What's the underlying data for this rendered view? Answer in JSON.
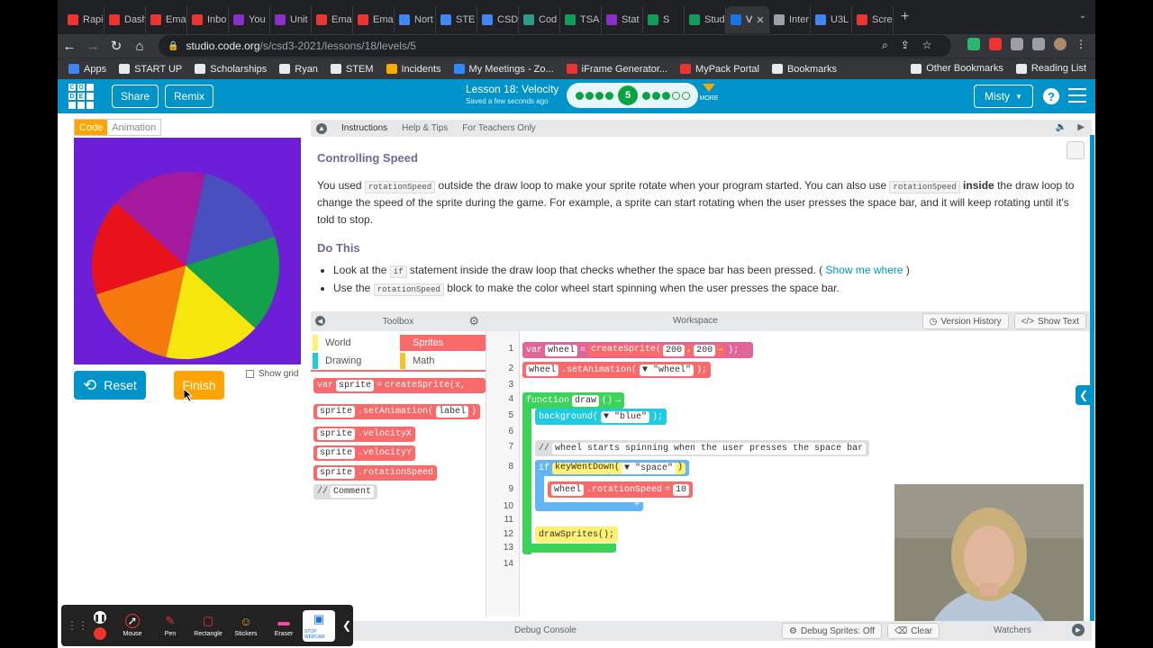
{
  "browser": {
    "tabs": [
      {
        "label": "Rapi",
        "color": "#e33"
      },
      {
        "label": "Dash",
        "color": "#e33"
      },
      {
        "label": "Ema",
        "color": "#e33"
      },
      {
        "label": "Inbo",
        "color": "#e33"
      },
      {
        "label": "You",
        "color": "#8b2fc9"
      },
      {
        "label": "Unit",
        "color": "#8b2fc9"
      },
      {
        "label": "Ema",
        "color": "#e33"
      },
      {
        "label": "Ema",
        "color": "#e33"
      },
      {
        "label": "Nort",
        "color": "#4285f4"
      },
      {
        "label": "STE",
        "color": "#4285f4"
      },
      {
        "label": "CSD",
        "color": "#4285f4"
      },
      {
        "label": "Cod",
        "color": "#2e9a8a"
      },
      {
        "label": "TSA",
        "color": "#0f9d58"
      },
      {
        "label": "Stat",
        "color": "#8b2fc9"
      },
      {
        "label": "S",
        "color": "#0f9d58"
      },
      {
        "label": "Stud",
        "color": "#0f9d58"
      },
      {
        "label": "V",
        "color": "#1a73e8",
        "active": true
      },
      {
        "label": "Inter",
        "color": "#9aa0a6"
      },
      {
        "label": "U3L",
        "color": "#4285f4"
      },
      {
        "label": "Scre",
        "color": "#e33"
      }
    ],
    "url_host": "studio.code.org",
    "url_path": "/s/csd3-2021/lessons/18/levels/5",
    "bookmarks": [
      "Apps",
      "START UP",
      "Scholarships",
      "Ryan",
      "STEM",
      "Incidents",
      "My Meetings - Zo...",
      "iFrame Generator...",
      "MyPack Portal",
      "Bookmarks"
    ],
    "bookmarks_right": [
      "Other Bookmarks",
      "Reading List"
    ]
  },
  "header": {
    "share": "Share",
    "remix": "Remix",
    "lesson_title": "Lesson 18: Velocity",
    "saved": "Saved a few seconds ago",
    "current_level": "5",
    "more": "MORE",
    "user": "Misty"
  },
  "visualization": {
    "tab_code": "Code",
    "tab_animation": "Animation",
    "reset": "Reset",
    "finish": "Finish",
    "show_grid": "Show grid",
    "wheel_colors": [
      "#4a4fbf",
      "#11a24a",
      "#f5e60e",
      "#f57a0e",
      "#e8121b",
      "#a31a9f"
    ]
  },
  "instructions": {
    "tabs": [
      "Instructions",
      "Help & Tips",
      "For Teachers Only"
    ],
    "heading": "Controlling Speed",
    "p_start": "You used",
    "p_chip1": "rotationSpeed",
    "p_mid": "outside the draw loop to make your sprite rotate when your program started. You can also use",
    "p_chip2": "rotationSpeed",
    "p_bold": "inside",
    "p_end": "the draw loop to change the speed of the sprite during the game. For example, a sprite can start rotating when the user presses the space bar, and it will keep rotating until it's told to stop.",
    "do_this": "Do This",
    "b1_start": "Look at the",
    "b1_chip": "if",
    "b1_mid": "statement inside the draw loop that checks whether the space bar has been pressed. (",
    "b1_link": "Show me where",
    "b1_end": ")",
    "b2_start": "Use the",
    "b2_chip": "rotationSpeed",
    "b2_end": "block to make the color wheel start spinning when the user presses the space bar."
  },
  "toolbox": {
    "title": "Toolbox",
    "categories": [
      {
        "label": "World",
        "color": "#fff176",
        "selected": false
      },
      {
        "label": "Sprites",
        "color": "#fa6a6a",
        "selected": true
      },
      {
        "label": "Drawing",
        "color": "#1ecbe1",
        "selected": false
      },
      {
        "label": "Math",
        "color": "#ffc02e",
        "selected": false
      }
    ],
    "blocks": {
      "var_kw": "var",
      "var_name": "sprite",
      "eq": "=",
      "create": "createSprite(x,",
      "anim_obj": "sprite",
      "anim_prop": ".setAnimation(",
      "anim_arg": "label",
      "anim_close": ")",
      "vx_obj": "sprite",
      "vx_prop": ".velocityX",
      "vy_obj": "sprite",
      "vy_prop": ".velocityY",
      "rs_obj": "sprite",
      "rs_prop": ".rotationSpeed",
      "comment_slash": "//",
      "comment_text": "Comment"
    }
  },
  "workspace": {
    "title": "Workspace",
    "version_history": "Version History",
    "show_text": "Show Text",
    "line_numbers": [
      "1",
      "2",
      "3",
      "4",
      "5",
      "6",
      "7",
      "8",
      "9",
      "10",
      "11",
      "12",
      "13",
      "14"
    ],
    "code": {
      "l1_var": "var",
      "l1_name": "wheel",
      "l1_eq": "=",
      "l1_fn": "createSprite(",
      "l1_a": "200",
      "l1_comma": ",",
      "l1_b": "200",
      "l1_end": ");",
      "l2_obj": "wheel",
      "l2_method": ".setAnimation(",
      "l2_arg": "▼ \"wheel\"",
      "l2_end": ");",
      "l4_fn": "function",
      "l4_name": "draw",
      "l4_paren": "()",
      "l5_fn": "background(",
      "l5_arg": "▼ \"blue\"",
      "l5_end": ");",
      "l7_slash": "//",
      "l7_text": "wheel starts spinning when the user presses the space bar",
      "l8_if": "if",
      "l8_fn": "keyWentDown(",
      "l8_arg": "▼ \"space\"",
      "l8_end": ")",
      "l9_obj": "wheel",
      "l9_prop": ".rotationSpeed",
      "l9_eq": "=",
      "l9_val": "10",
      "l12_fn": "drawSprites();"
    }
  },
  "debug": {
    "console": "Debug Console",
    "sprites": "Debug Sprites: Off",
    "clear": "Clear",
    "watchers": "Watchers"
  },
  "annotation_tools": [
    "Mouse",
    "Pen",
    "Rectangle",
    "Stickers",
    "Eraser",
    "STOP WEBCAM"
  ]
}
